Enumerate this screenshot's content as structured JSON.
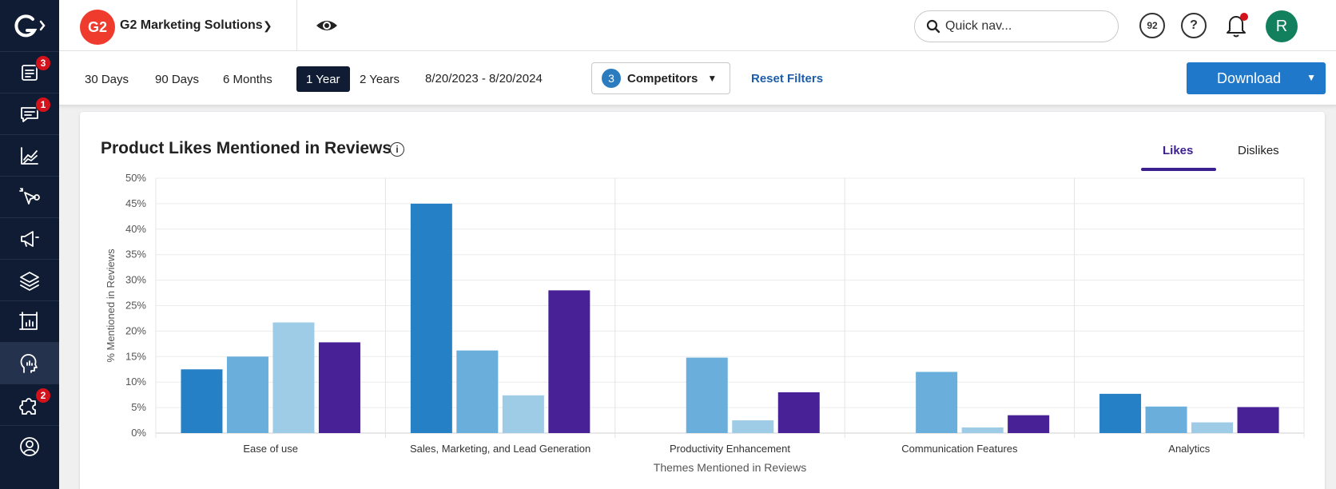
{
  "sidebar": {
    "logo": "G2",
    "items": [
      {
        "icon": "reports-icon",
        "badge": "3"
      },
      {
        "icon": "chat-icon",
        "badge": "1"
      },
      {
        "icon": "analytics-icon",
        "badge": ""
      },
      {
        "icon": "intent-icon",
        "badge": ""
      },
      {
        "icon": "megaphone-icon",
        "badge": ""
      },
      {
        "icon": "layers-icon",
        "badge": ""
      },
      {
        "icon": "frame-icon",
        "badge": ""
      },
      {
        "icon": "head-insights-icon",
        "badge": ""
      },
      {
        "icon": "integrations-icon",
        "badge": "2"
      },
      {
        "icon": "profile-icon",
        "badge": ""
      }
    ]
  },
  "header": {
    "org_logo_text": "G2",
    "org_name": "G2 Marketing Solutions",
    "search_placeholder": "Quick nav...",
    "score": "92",
    "help": "?",
    "avatar_initial": "R"
  },
  "filters": {
    "ranges": [
      "30 Days",
      "90 Days",
      "6 Months",
      "1 Year",
      "2 Years"
    ],
    "active_range": "1 Year",
    "date_range": "8/20/2023 - 8/20/2024",
    "competitors_count": "3",
    "competitors_label": "Competitors",
    "reset_label": "Reset Filters",
    "download_label": "Download"
  },
  "card": {
    "title": "Product Likes Mentioned in Reviews",
    "tabs": [
      "Likes",
      "Dislikes"
    ],
    "active_tab": "Likes"
  },
  "chart_data": {
    "type": "bar",
    "categories": [
      "Ease of use",
      "Sales, Marketing, and Lead Generation",
      "Productivity Enhancement",
      "Communication Features",
      "Analytics"
    ],
    "series": [
      {
        "color": "#2680c6",
        "values": [
          12.5,
          45,
          0,
          0,
          7.7
        ]
      },
      {
        "color": "#6aaedc",
        "values": [
          15,
          16.2,
          14.8,
          12,
          5.2
        ]
      },
      {
        "color": "#9ecbe6",
        "values": [
          21.7,
          7.4,
          2.5,
          1.1,
          2.1
        ]
      },
      {
        "color": "#472195",
        "values": [
          17.8,
          28,
          8,
          3.5,
          5.1
        ]
      }
    ],
    "xlabel": "Themes Mentioned in Reviews",
    "ylabel": "% Mentioned in Reviews",
    "ylim": [
      0,
      50
    ],
    "yticks": [
      "0%",
      "5%",
      "10%",
      "15%",
      "20%",
      "25%",
      "30%",
      "35%",
      "40%",
      "45%",
      "50%"
    ],
    "grid": true
  }
}
